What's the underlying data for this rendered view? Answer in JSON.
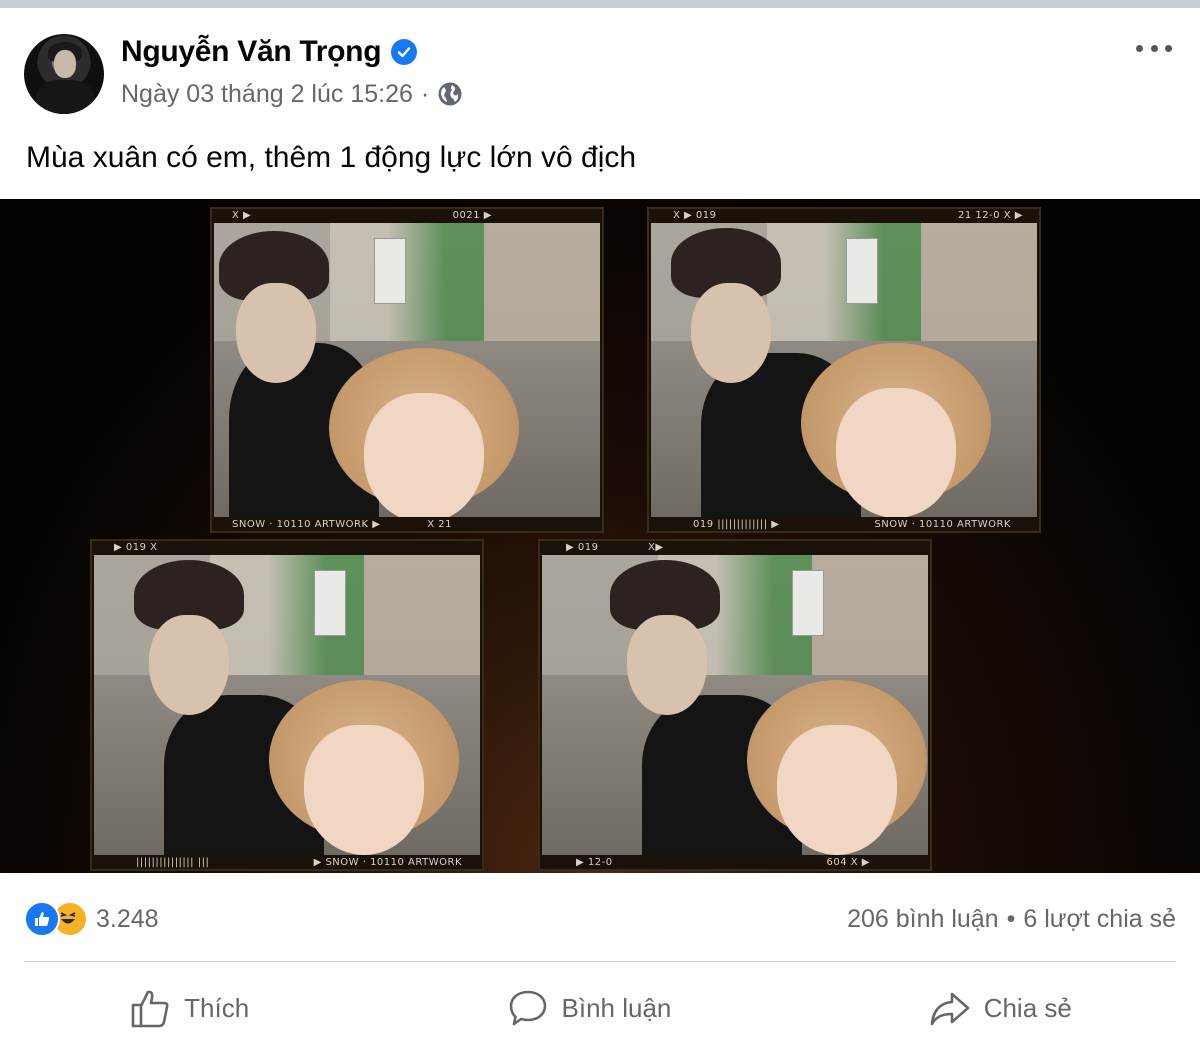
{
  "post": {
    "author": "Nguyễn Văn Trọng",
    "timestamp": "Ngày 03 tháng 2 lúc 15:26",
    "separator": "·",
    "privacy_icon": "globe-icon",
    "text": "Mùa xuân có em, thêm 1 động lực lớn vô địch"
  },
  "media": {
    "frames": [
      {
        "caption_top_left": "X ▶",
        "caption_top_right": "0021 ▶",
        "caption_bottom_left": "SNOW · 10110 ARTWORK ▶",
        "caption_bottom_right": "X 21"
      },
      {
        "caption_top_left": "X ▶ 019",
        "caption_top_right": "21  12-0   X ▶",
        "caption_bottom_left": "019  ||||||||||||| ▶",
        "caption_bottom_right": "SNOW · 10110 ARTWORK"
      },
      {
        "caption_top_left": "▶ 019          X",
        "caption_top_right": "",
        "caption_bottom_left": "||||||||||||||| |||",
        "caption_bottom_right": "▶ SNOW · 10110 ARTWORK"
      },
      {
        "caption_top_left": "▶ 019",
        "caption_top_right": "X▶",
        "caption_bottom_left": "▶ 12-0",
        "caption_bottom_right": "604  X ▶"
      }
    ]
  },
  "stats": {
    "reaction_icons": [
      "like-icon",
      "haha-icon"
    ],
    "reaction_count": "3.248",
    "comments": "206 bình luận",
    "dot": "•",
    "shares": "6 lượt chia sẻ"
  },
  "actions": {
    "like": "Thích",
    "comment": "Bình luận",
    "share": "Chia sẻ"
  },
  "colors": {
    "accent": "#1877f2",
    "secondary_text": "#65676b",
    "haha": "#f7b125"
  }
}
